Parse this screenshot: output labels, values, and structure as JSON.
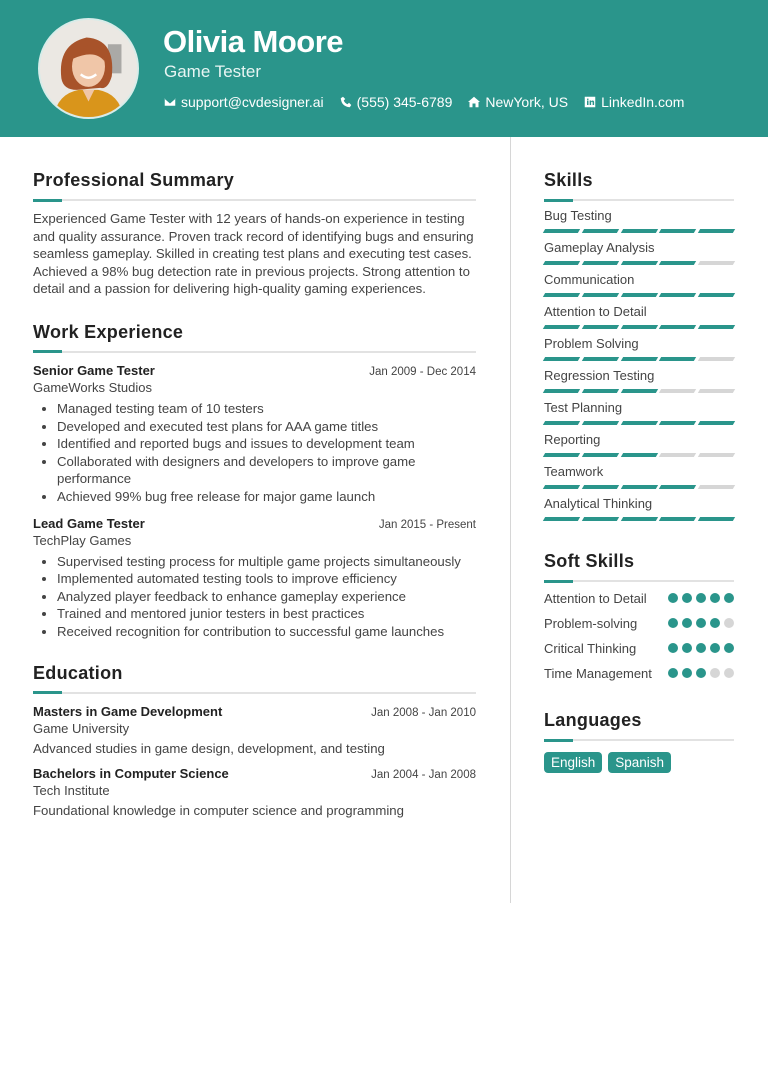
{
  "header": {
    "name": "Olivia Moore",
    "title": "Game Tester",
    "contacts": [
      {
        "icon": "envelope-icon",
        "text": "support@cvdesigner.ai"
      },
      {
        "icon": "phone-icon",
        "text": "(555) 345-6789"
      },
      {
        "icon": "home-icon",
        "text": "NewYork, US"
      },
      {
        "icon": "linkedin-icon",
        "text": "LinkedIn.com"
      }
    ]
  },
  "colors": {
    "accent": "#2a958b",
    "inactive": "#d6d6d6"
  },
  "summary": {
    "heading": "Professional Summary",
    "text": "Experienced Game Tester with 12 years of hands-on experience in testing and quality assurance. Proven track record of identifying bugs and ensuring seamless gameplay. Skilled in creating test plans and executing test cases. Achieved a 98% bug detection rate in previous projects. Strong attention to detail and a passion for delivering high-quality gaming experiences."
  },
  "experience": {
    "heading": "Work Experience",
    "jobs": [
      {
        "role": "Senior Game Tester",
        "dates": "Jan 2009 - Dec 2014",
        "company": "GameWorks Studios",
        "bullets": [
          "Managed testing team of 10 testers",
          "Developed and executed test plans for AAA game titles",
          "Identified and reported bugs and issues to development team",
          "Collaborated with designers and developers to improve game performance",
          "Achieved 99% bug free release for major game launch"
        ]
      },
      {
        "role": "Lead Game Tester",
        "dates": "Jan 2015 - Present",
        "company": "TechPlay Games",
        "bullets": [
          "Supervised testing process for multiple game projects simultaneously",
          "Implemented automated testing tools to improve efficiency",
          "Analyzed player feedback to enhance gameplay experience",
          "Trained and mentored junior testers in best practices",
          "Received recognition for contribution to successful game launches"
        ]
      }
    ]
  },
  "education": {
    "heading": "Education",
    "items": [
      {
        "degree": "Masters in Game Development",
        "dates": "Jan 2008 - Jan 2010",
        "school": "Game University",
        "desc": "Advanced studies in game design, development, and testing"
      },
      {
        "degree": "Bachelors in Computer Science",
        "dates": "Jan 2004 - Jan 2008",
        "school": "Tech Institute",
        "desc": "Foundational knowledge in computer science and programming"
      }
    ]
  },
  "skills": {
    "heading": "Skills",
    "max": 5,
    "items": [
      {
        "name": "Bug Testing",
        "level": 5
      },
      {
        "name": "Gameplay Analysis",
        "level": 4
      },
      {
        "name": "Communication",
        "level": 5
      },
      {
        "name": "Attention to Detail",
        "level": 5
      },
      {
        "name": "Problem Solving",
        "level": 4
      },
      {
        "name": "Regression Testing",
        "level": 3
      },
      {
        "name": "Test Planning",
        "level": 5
      },
      {
        "name": "Reporting",
        "level": 3
      },
      {
        "name": "Teamwork",
        "level": 4
      },
      {
        "name": "Analytical Thinking",
        "level": 5
      }
    ]
  },
  "soft_skills": {
    "heading": "Soft Skills",
    "max": 5,
    "items": [
      {
        "name": "Attention to Detail",
        "level": 5
      },
      {
        "name": "Problem-solving",
        "level": 4
      },
      {
        "name": "Critical Thinking",
        "level": 5
      },
      {
        "name": "Time Management",
        "level": 3
      }
    ]
  },
  "languages": {
    "heading": "Languages",
    "items": [
      "English",
      "Spanish"
    ]
  }
}
